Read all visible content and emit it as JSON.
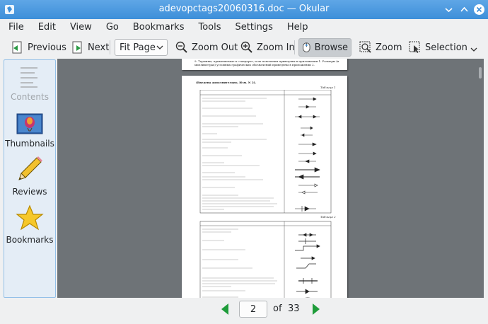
{
  "window": {
    "title": "adevopctags20060316.doc — Okular"
  },
  "menubar": {
    "items": [
      "File",
      "Edit",
      "View",
      "Go",
      "Bookmarks",
      "Tools",
      "Settings",
      "Help"
    ]
  },
  "toolbar": {
    "previous_label": "Previous",
    "next_label": "Next",
    "fit_mode": "Fit Page",
    "zoom_out_label": "Zoom Out",
    "zoom_in_label": "Zoom In",
    "browse_label": "Browse",
    "zoom_label": "Zoom",
    "selection_label": "Selection"
  },
  "sidebar": {
    "items": [
      {
        "label": "Contents",
        "icon": "contents-icon",
        "enabled": false
      },
      {
        "label": "Thumbnails",
        "icon": "thumbnails-icon",
        "enabled": true
      },
      {
        "label": "Reviews",
        "icon": "pencil-icon",
        "enabled": true
      },
      {
        "label": "Bookmarks",
        "icon": "star-icon",
        "enabled": true
      }
    ]
  },
  "document": {
    "page1_text": "9. Термины, применяемые в стандарте, и их пояснения приведены в приложении 1. Размеры (в миллиметрах) условных графических обозначений приведены в приложении 2.",
    "page2_heading": "(Введена дополнительно, Изм. N 2).",
    "table1_label": "Таблица 1",
    "table2_label": "Таблица 2"
  },
  "navigation": {
    "current_page": "2",
    "of_label": "of",
    "total_pages": "33"
  },
  "colors": {
    "titlebar": "#3d8fd9",
    "sidebar_border": "#93c0e8",
    "doc_background": "#6e7377",
    "nav_arrow": "#1e9c3a"
  }
}
